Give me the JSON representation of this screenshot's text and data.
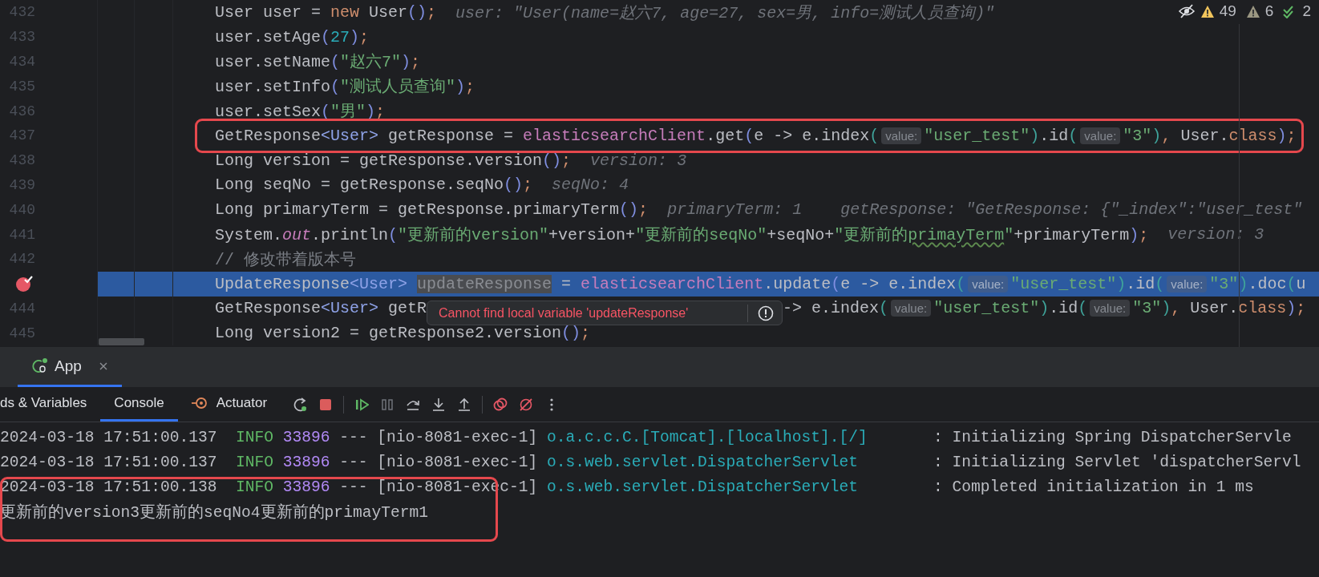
{
  "editor": {
    "inspections": [
      {
        "kind": "warning",
        "count": "49"
      },
      {
        "kind": "weak_warning",
        "count": "6"
      },
      {
        "kind": "ok",
        "count": "2"
      }
    ],
    "lines": [
      {
        "number": "432",
        "breakpoint": false,
        "current": false,
        "boxed": false,
        "tokens": [
          {
            "kind": "plain",
            "text": "User user = "
          },
          {
            "kind": "keyword",
            "text": "new"
          },
          {
            "kind": "plain",
            "text": " User"
          },
          {
            "kind": "paren",
            "text": "()"
          },
          {
            "kind": "keyword",
            "text": ";"
          },
          {
            "kind": "hint",
            "text": "user: \"User(name=赵六7, age=27, sex=男, info=测试人员查询)\""
          }
        ]
      },
      {
        "number": "433",
        "breakpoint": false,
        "current": false,
        "boxed": false,
        "tokens": [
          {
            "kind": "plain",
            "text": "user.setAge"
          },
          {
            "kind": "paren",
            "text": "("
          },
          {
            "kind": "number",
            "text": "27"
          },
          {
            "kind": "paren",
            "text": ")"
          },
          {
            "kind": "keyword",
            "text": ";"
          }
        ]
      },
      {
        "number": "434",
        "breakpoint": false,
        "current": false,
        "boxed": false,
        "tokens": [
          {
            "kind": "plain",
            "text": "user.setName"
          },
          {
            "kind": "paren",
            "text": "("
          },
          {
            "kind": "string",
            "text": "\"赵六7\""
          },
          {
            "kind": "paren",
            "text": ")"
          },
          {
            "kind": "keyword",
            "text": ";"
          }
        ]
      },
      {
        "number": "435",
        "breakpoint": false,
        "current": false,
        "boxed": false,
        "tokens": [
          {
            "kind": "plain",
            "text": "user.setInfo"
          },
          {
            "kind": "paren",
            "text": "("
          },
          {
            "kind": "string",
            "text": "\"测试人员查询\""
          },
          {
            "kind": "paren",
            "text": ")"
          },
          {
            "kind": "keyword",
            "text": ";"
          }
        ]
      },
      {
        "number": "436",
        "breakpoint": false,
        "current": false,
        "boxed": false,
        "tokens": [
          {
            "kind": "plain",
            "text": "user.setSex"
          },
          {
            "kind": "paren",
            "text": "("
          },
          {
            "kind": "string",
            "text": "\"男\""
          },
          {
            "kind": "paren",
            "text": ")"
          },
          {
            "kind": "keyword",
            "text": ";"
          }
        ]
      },
      {
        "number": "437",
        "breakpoint": false,
        "current": false,
        "boxed": true,
        "tokens": [
          {
            "kind": "plain",
            "text": "GetResponse"
          },
          {
            "kind": "typearg",
            "text": "<User>"
          },
          {
            "kind": "plain",
            "text": " getResponse = "
          },
          {
            "kind": "field",
            "text": "elasticsearchClient"
          },
          {
            "kind": "plain",
            "text": ".get"
          },
          {
            "kind": "paren",
            "text": "("
          },
          {
            "kind": "plain",
            "text": "e -> e.index"
          },
          {
            "kind": "paren2",
            "text": "("
          },
          {
            "kind": "inlay",
            "text": "value:"
          },
          {
            "kind": "string",
            "text": "\"user_test\""
          },
          {
            "kind": "paren2",
            "text": ")"
          },
          {
            "kind": "plain",
            "text": ".id"
          },
          {
            "kind": "paren2",
            "text": "("
          },
          {
            "kind": "inlay",
            "text": "value:"
          },
          {
            "kind": "string",
            "text": "\"3\""
          },
          {
            "kind": "paren2",
            "text": ")"
          },
          {
            "kind": "keyword",
            "text": ","
          },
          {
            "kind": "plain",
            "text": " User."
          },
          {
            "kind": "keyword",
            "text": "class"
          },
          {
            "kind": "paren",
            "text": ")"
          },
          {
            "kind": "keyword",
            "text": ";"
          }
        ]
      },
      {
        "number": "438",
        "breakpoint": false,
        "current": false,
        "boxed": false,
        "tokens": [
          {
            "kind": "plain",
            "text": "Long version = getResponse.version"
          },
          {
            "kind": "paren",
            "text": "()"
          },
          {
            "kind": "keyword",
            "text": ";"
          },
          {
            "kind": "hint",
            "text": "version: 3"
          }
        ]
      },
      {
        "number": "439",
        "breakpoint": false,
        "current": false,
        "boxed": false,
        "tokens": [
          {
            "kind": "plain",
            "text": "Long seqNo = getResponse.seqNo"
          },
          {
            "kind": "paren",
            "text": "()"
          },
          {
            "kind": "keyword",
            "text": ";"
          },
          {
            "kind": "hint",
            "text": "seqNo: 4"
          }
        ]
      },
      {
        "number": "440",
        "breakpoint": false,
        "current": false,
        "boxed": false,
        "tokens": [
          {
            "kind": "plain",
            "text": "Long primaryTerm = getResponse.primaryTerm"
          },
          {
            "kind": "paren",
            "text": "()"
          },
          {
            "kind": "keyword",
            "text": ";"
          },
          {
            "kind": "hint",
            "text": "primaryTerm: 1"
          },
          {
            "kind": "hint",
            "text": "getResponse: \"GetResponse: {\"_index\":\"user_test\""
          }
        ]
      },
      {
        "number": "441",
        "breakpoint": false,
        "current": false,
        "boxed": false,
        "tokens": [
          {
            "kind": "plain",
            "text": "System."
          },
          {
            "kind": "static",
            "text": "out"
          },
          {
            "kind": "plain",
            "text": ".println"
          },
          {
            "kind": "paren",
            "text": "("
          },
          {
            "kind": "string",
            "text": "\"更新前的version\""
          },
          {
            "kind": "plain",
            "text": "+version+"
          },
          {
            "kind": "string",
            "text": "\"更新前的seqNo\""
          },
          {
            "kind": "plain",
            "text": "+seqNo+"
          },
          {
            "kind": "string",
            "text": "\"更新前的"
          },
          {
            "kind": "typo",
            "text": "primayTerm"
          },
          {
            "kind": "string",
            "text": "\""
          },
          {
            "kind": "plain",
            "text": "+primaryTerm"
          },
          {
            "kind": "paren",
            "text": ")"
          },
          {
            "kind": "keyword",
            "text": ";"
          },
          {
            "kind": "hint",
            "text": "version: 3"
          }
        ]
      },
      {
        "number": "442",
        "breakpoint": false,
        "current": false,
        "boxed": false,
        "tokens": [
          {
            "kind": "comment",
            "text": "// 修改带着版本号"
          }
        ]
      },
      {
        "breakpoint": true,
        "current": true,
        "boxed": false,
        "tokens": [
          {
            "kind": "plain",
            "text": "UpdateResponse"
          },
          {
            "kind": "typearg",
            "text": "<User> "
          },
          {
            "kind": "unused",
            "text": "updateResponse"
          },
          {
            "kind": "plain",
            "text": " = "
          },
          {
            "kind": "field",
            "text": "elasticsearchClient"
          },
          {
            "kind": "plain",
            "text": ".update"
          },
          {
            "kind": "paren",
            "text": "("
          },
          {
            "kind": "plain",
            "text": "e -> e.index"
          },
          {
            "kind": "paren2",
            "text": "("
          },
          {
            "kind": "inlay",
            "text": "value:"
          },
          {
            "kind": "string",
            "text": "\"user_test\""
          },
          {
            "kind": "paren2",
            "text": ")"
          },
          {
            "kind": "plain",
            "text": ".id"
          },
          {
            "kind": "paren2",
            "text": "("
          },
          {
            "kind": "inlay",
            "text": "value:"
          },
          {
            "kind": "string",
            "text": "\"3\""
          },
          {
            "kind": "paren2",
            "text": ")"
          },
          {
            "kind": "plain",
            "text": ".doc"
          },
          {
            "kind": "paren2",
            "text": "("
          },
          {
            "kind": "plain",
            "text": "u"
          }
        ]
      },
      {
        "number": "444",
        "breakpoint": false,
        "current": false,
        "boxed": false,
        "tokens": [
          {
            "kind": "plain",
            "text": "GetResponse"
          },
          {
            "kind": "typearg",
            "text": "<User>"
          },
          {
            "kind": "plain",
            "text": " getR"
          }
        ],
        "popup": {
          "message": "Cannot find local variable 'updateResponse'"
        },
        "tokens_after": [
          {
            "kind": "plain",
            "text": "-> e.index"
          },
          {
            "kind": "paren2",
            "text": "("
          },
          {
            "kind": "inlay",
            "text": "value:"
          },
          {
            "kind": "string",
            "text": "\"user_test\""
          },
          {
            "kind": "paren2",
            "text": ")"
          },
          {
            "kind": "plain",
            "text": ".id"
          },
          {
            "kind": "paren2",
            "text": "("
          },
          {
            "kind": "inlay",
            "text": "value:"
          },
          {
            "kind": "string",
            "text": "\"3\""
          },
          {
            "kind": "paren2",
            "text": ")"
          },
          {
            "kind": "keyword",
            "text": ","
          },
          {
            "kind": "plain",
            "text": " User."
          },
          {
            "kind": "keyword",
            "text": "class"
          },
          {
            "kind": "paren",
            "text": ")"
          },
          {
            "kind": "keyword",
            "text": ";"
          }
        ]
      },
      {
        "number": "445",
        "breakpoint": false,
        "current": false,
        "boxed": false,
        "tokens": [
          {
            "kind": "plain",
            "text": "Long version2 = getResponse2.version"
          },
          {
            "kind": "paren",
            "text": "()"
          },
          {
            "kind": "keyword",
            "text": ";"
          }
        ]
      }
    ]
  },
  "debug_panel": {
    "session_tabs": [
      {
        "label": "App",
        "selected": true
      }
    ],
    "tabs": [
      {
        "label": "ds & Variables",
        "selected": false,
        "icon": false
      },
      {
        "label": "Console",
        "selected": true,
        "icon": false
      },
      {
        "label": "Actuator",
        "selected": false,
        "icon": true
      }
    ],
    "console": {
      "lines": [
        {
          "kind": "log",
          "boxed": false,
          "timestamp": "2024-03-18 17:51:00.137",
          "level": "INFO",
          "pid": "33896",
          "separator": "---",
          "thread": "[nio-8081-exec-1]",
          "logger": "o.a.c.c.C.[Tomcat].[localhost].[/]",
          "message": ": Initializing Spring DispatcherServle"
        },
        {
          "kind": "log",
          "boxed": false,
          "timestamp": "2024-03-18 17:51:00.137",
          "level": "INFO",
          "pid": "33896",
          "separator": "---",
          "thread": "[nio-8081-exec-1]",
          "logger": "o.s.web.servlet.DispatcherServlet",
          "message": ": Initializing Servlet 'dispatcherServl"
        },
        {
          "kind": "log",
          "boxed": true,
          "timestamp": "2024-03-18 17:51:00.138",
          "level": "INFO",
          "pid": "33896",
          "separator": "---",
          "thread": "[nio-8081-exec-1]",
          "logger": "o.s.web.servlet.DispatcherServlet",
          "message": ": Completed initialization in 1 ms"
        },
        {
          "kind": "output",
          "boxed": true,
          "text": "更新前的version3更新前的seqNo4更新前的primayTerm1"
        }
      ]
    }
  }
}
